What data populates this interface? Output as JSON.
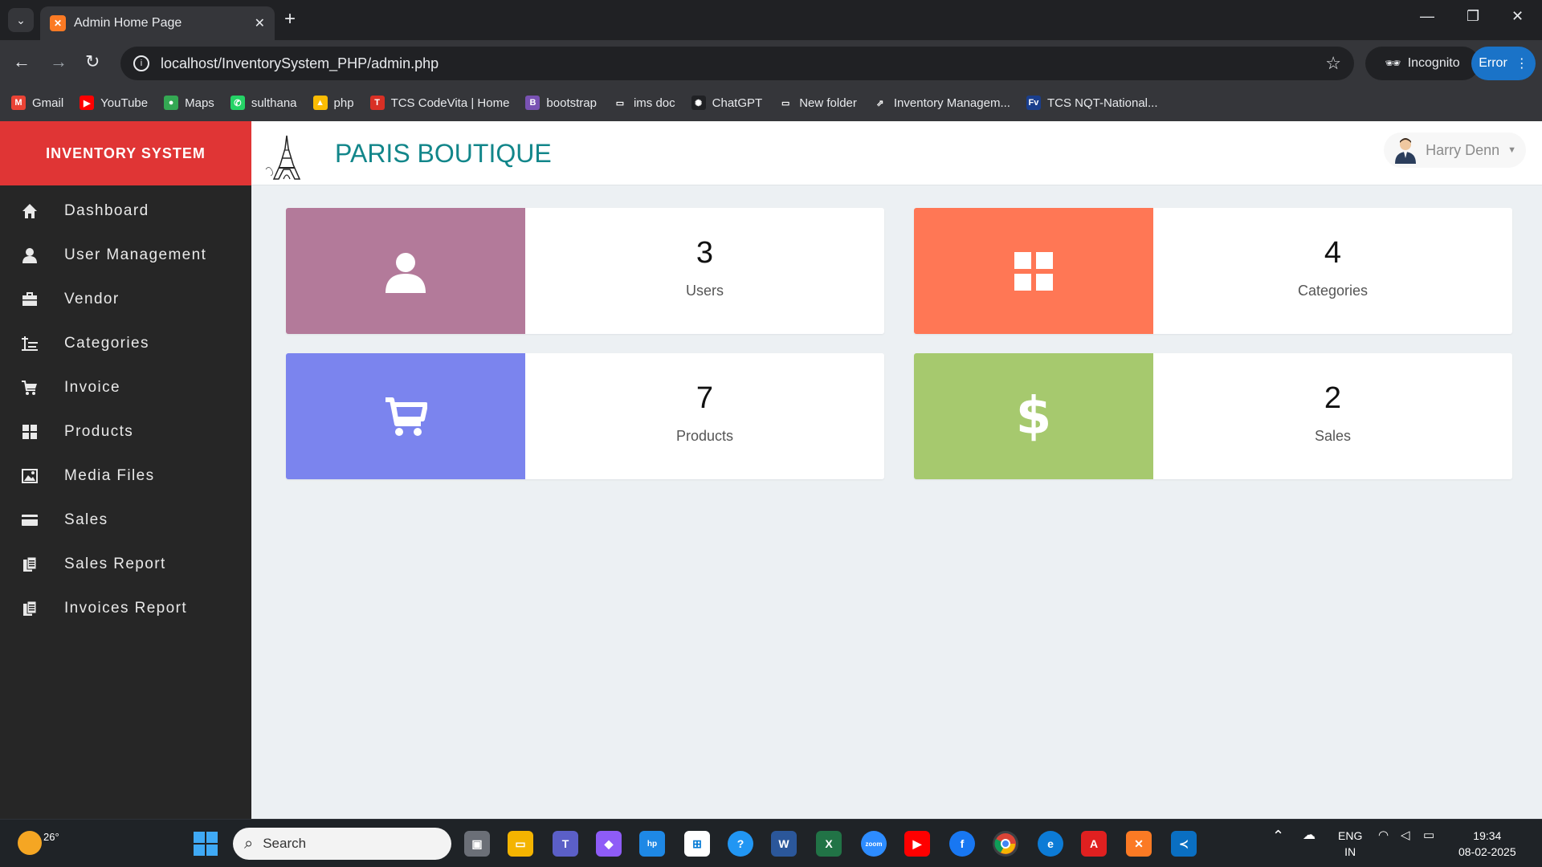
{
  "browser": {
    "tab_title": "Admin Home Page",
    "tab_close": "✕",
    "url": "localhost/InventorySystem_PHP/admin.php",
    "incognito_label": "Incognito",
    "error_label": "Error",
    "bookmarks": [
      {
        "label": "Gmail",
        "icon": "gmail-icon",
        "color": "#ea4335",
        "glyph": "M"
      },
      {
        "label": "YouTube",
        "icon": "youtube-icon",
        "color": "#ff0000",
        "glyph": "▶"
      },
      {
        "label": "Maps",
        "icon": "maps-icon",
        "color": "#34a853",
        "glyph": "●"
      },
      {
        "label": "sulthana",
        "icon": "whatsapp-icon",
        "color": "#25d366",
        "glyph": "✆"
      },
      {
        "label": "php",
        "icon": "drive-icon",
        "color": "#fbbc04",
        "glyph": "▲"
      },
      {
        "label": "TCS CodeVita | Home",
        "icon": "tcs-icon",
        "color": "#d93025",
        "glyph": "T"
      },
      {
        "label": "bootstrap",
        "icon": "bootstrap-icon",
        "color": "#7952b3",
        "glyph": "B"
      },
      {
        "label": "ims doc",
        "icon": "folder-icon",
        "color": "transparent",
        "glyph": "▭"
      },
      {
        "label": "ChatGPT",
        "icon": "chatgpt-icon",
        "color": "#202124",
        "glyph": "✺"
      },
      {
        "label": "New folder",
        "icon": "folder-icon",
        "color": "transparent",
        "glyph": "▭"
      },
      {
        "label": "Inventory Managem...",
        "icon": "link-icon",
        "color": "transparent",
        "glyph": "⇗"
      },
      {
        "label": "TCS NQT-National...",
        "icon": "fv-icon",
        "color": "#1a3e8c",
        "glyph": "Fv"
      }
    ]
  },
  "app": {
    "brand": "INVENTORY SYSTEM",
    "shop_name": "PARIS BOUTIQUE",
    "user_name": "Harry Denn"
  },
  "sidebar": {
    "items": [
      {
        "label": "Dashboard",
        "icon": "home-icon"
      },
      {
        "label": "User Management",
        "icon": "user-icon"
      },
      {
        "label": "Vendor",
        "icon": "briefcase-icon"
      },
      {
        "label": "Categories",
        "icon": "indent-icon"
      },
      {
        "label": "Invoice",
        "icon": "cart-icon"
      },
      {
        "label": "Products",
        "icon": "grid-icon"
      },
      {
        "label": "Media Files",
        "icon": "picture-icon"
      },
      {
        "label": "Sales",
        "icon": "credit-card-icon"
      },
      {
        "label": "Sales Report",
        "icon": "report-icon"
      },
      {
        "label": "Invoices Report",
        "icon": "report-icon"
      }
    ]
  },
  "cards": [
    {
      "count": "3",
      "label": "Users",
      "color": "#b37a9a",
      "icon": "user-icon"
    },
    {
      "count": "4",
      "label": "Categories",
      "color": "#ff7755",
      "icon": "grid-icon"
    },
    {
      "count": "7",
      "label": "Products",
      "color": "#7b84ee",
      "icon": "cart-icon"
    },
    {
      "count": "2",
      "label": "Sales",
      "color": "#a6c96e",
      "icon": "dollar-icon"
    }
  ],
  "taskbar": {
    "weather": "26°",
    "search_placeholder": "Search",
    "language": "ENG",
    "region": "IN",
    "time": "19:34",
    "date": "08-02-2025"
  }
}
